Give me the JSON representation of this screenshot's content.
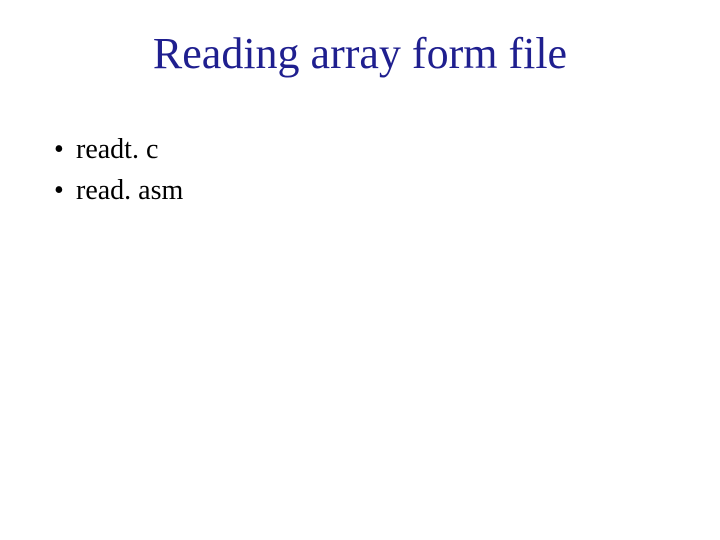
{
  "slide": {
    "title": "Reading array form file",
    "bullets": [
      "readt. c",
      "read. asm"
    ]
  },
  "colors": {
    "title": "#1f1f8f",
    "body": "#000000",
    "background": "#ffffff"
  }
}
